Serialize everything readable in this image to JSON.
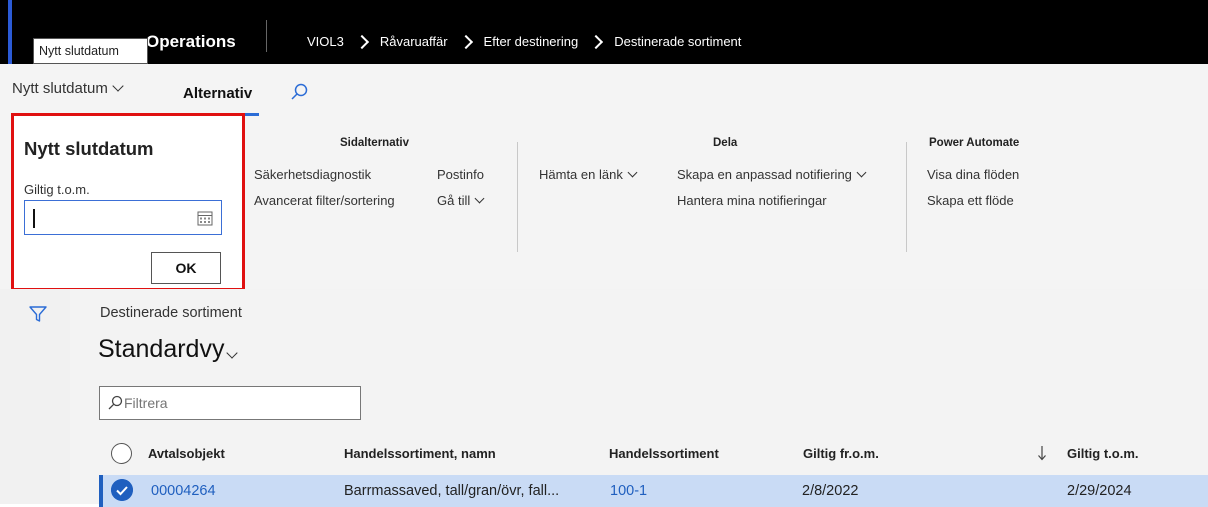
{
  "topbar": {
    "app_title": "Operations",
    "tooltip": "Nytt slutdatum",
    "breadcrumbs": [
      "VIOL3",
      "Råvaruaffär",
      "Efter destinering",
      "Destinerade sortiment"
    ]
  },
  "tabs": {
    "nytt_slutdatum": "Nytt slutdatum",
    "alternativ": "Alternativ"
  },
  "groups": {
    "sidalternativ": {
      "title": "Sidalternativ",
      "items": [
        "Säkerhetsdiagnostik",
        "Avancerat filter/sortering",
        "Postinfo",
        "Gå till"
      ]
    },
    "dela": {
      "title": "Dela",
      "items": [
        "Hämta en länk",
        "Skapa en anpassad notifiering",
        "Hantera mina notifieringar"
      ]
    },
    "power_automate": {
      "title": "Power Automate",
      "items": [
        "Visa dina flöden",
        "Skapa ett flöde"
      ]
    }
  },
  "flyout": {
    "title": "Nytt slutdatum",
    "field_label": "Giltig t.o.m.",
    "field_value": "",
    "ok_label": "OK"
  },
  "page": {
    "subtitle": "Destinerade sortiment",
    "view_name": "Standardvy",
    "filter_placeholder": "Filtrera"
  },
  "grid": {
    "columns": [
      "Avtalsobjekt",
      "Handelssortiment, namn",
      "Handelssortiment",
      "Giltig fr.o.m.",
      "Giltig t.o.m."
    ],
    "rows": [
      {
        "avtalsobjekt": "00004264",
        "namn": "Barrmassaved, tall/gran/övr, fall...",
        "sortiment": "100-1",
        "from": "2/8/2022",
        "tom": "2/29/2024"
      }
    ]
  },
  "colors": {
    "accent": "#2b6cd6",
    "highlight_border": "#e01010",
    "selected_row": "#c9dbf5"
  }
}
